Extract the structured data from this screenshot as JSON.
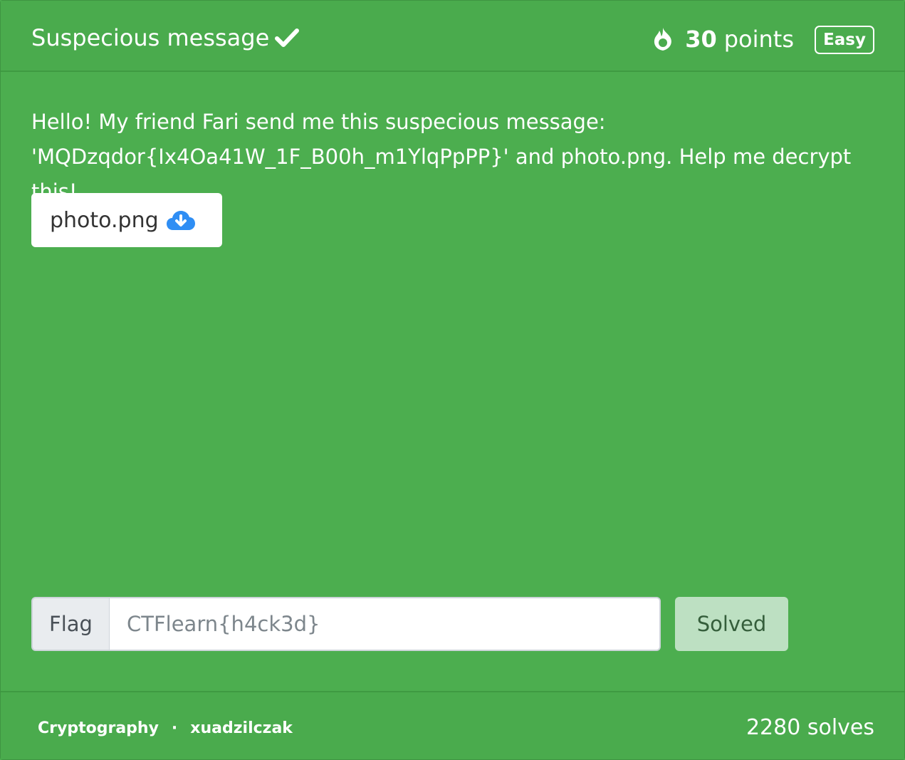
{
  "challenge": {
    "title": "Suspecious message",
    "points_value": "30",
    "points_unit": "points",
    "difficulty": "Easy",
    "description_line1": "Hello! My friend Fari send me this suspecious message:",
    "description_line2": "'MQDzqdor{Ix4Oa41W_1F_B00h_m1YlqPpPP}' and photo.png. Help me decrypt this!",
    "file_name": "photo.png",
    "category": "Cryptography",
    "separator": "·",
    "author": "xuadzilczak",
    "solves": "2280 solves"
  },
  "flag_form": {
    "label": "Flag",
    "placeholder": "CTFlearn{h4ck3d}",
    "value": "",
    "button_label": "Solved"
  },
  "colors": {
    "card_background": "#4cae4f",
    "solved_button_background": "#bde0c2",
    "cloud_icon": "#2f8ef4"
  },
  "icons": {
    "title_status": "check-icon",
    "points": "fire-icon",
    "file": "cloud-download-icon"
  }
}
